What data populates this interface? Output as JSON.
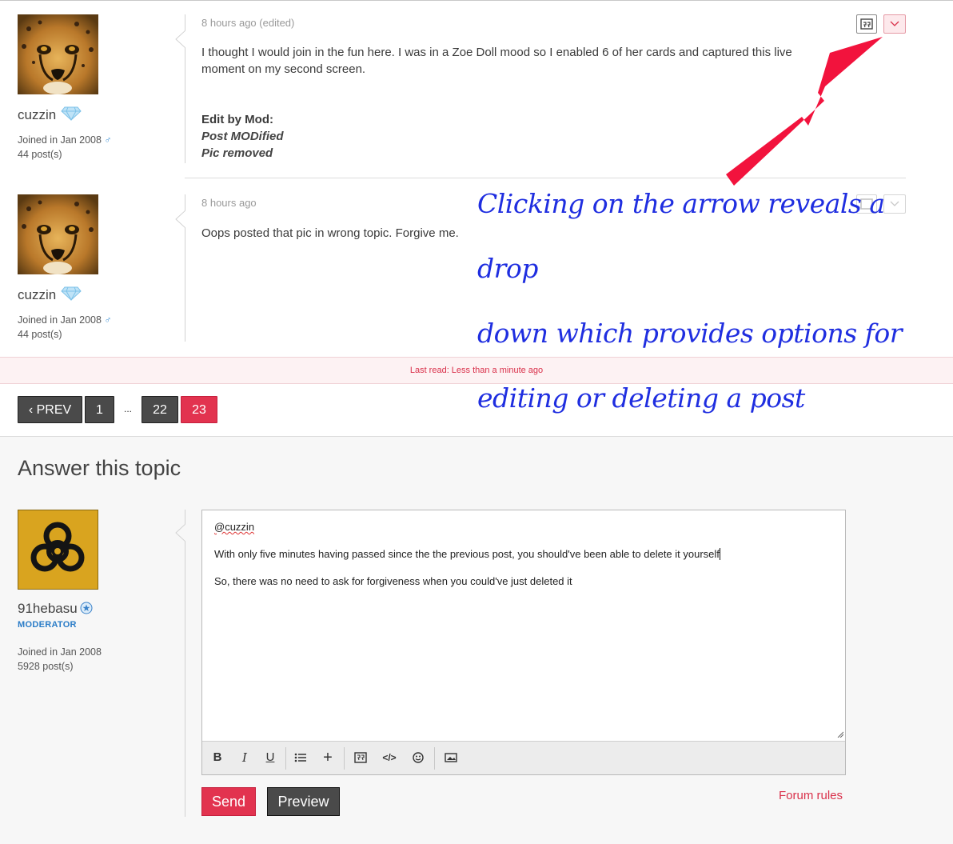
{
  "posts": [
    {
      "username": "cuzzin",
      "joined": "Joined in Jan 2008",
      "posts": "44 post(s)",
      "timestamp": "8 hours ago (edited)",
      "body": "I thought I would join in the fun here. I was in a Zoe Doll mood so I enabled 6 of her cards and captured this live moment on my second screen.",
      "mod_title": "Edit by Mod:",
      "mod_line1": "Post MODified",
      "mod_line2": "Pic removed"
    },
    {
      "username": "cuzzin",
      "joined": "Joined in Jan 2008",
      "posts": "44 post(s)",
      "timestamp": "8 hours ago",
      "body": "Oops posted that pic in wrong topic. Forgive me."
    }
  ],
  "last_read": "Last read: Less than a minute ago",
  "pagination": {
    "prev": "PREV",
    "first": "1",
    "ellipsis": "...",
    "p22": "22",
    "p23": "23"
  },
  "answer": {
    "title": "Answer this topic",
    "username": "91hebasu",
    "role": "MODERATOR",
    "joined": "Joined in Jan 2008",
    "posts": "5928 post(s)",
    "editor_lines": [
      "@cuzzin",
      "With only five minutes having passed since the the previous post, you should've been able to delete it yourself",
      "So, there was no need to ask for forgiveness when you could've just deleted it"
    ],
    "send_label": "Send",
    "preview_label": "Preview",
    "rules_label": "Forum rules"
  },
  "annotation": {
    "line1": "Clicking on the arrow reveals a drop",
    "line2": "down which provides options for",
    "line3": "editing or deleting a post"
  },
  "icons": {
    "quote": "quote-icon",
    "dropdown": "chevron-down-icon",
    "male": "male-icon",
    "diamond": "diamond-icon"
  },
  "colors": {
    "accent_red": "#e2334f",
    "dark_button": "#4a4a4a",
    "annotation_blue": "#1f2ee0",
    "arrow_red": "#f2133d"
  }
}
